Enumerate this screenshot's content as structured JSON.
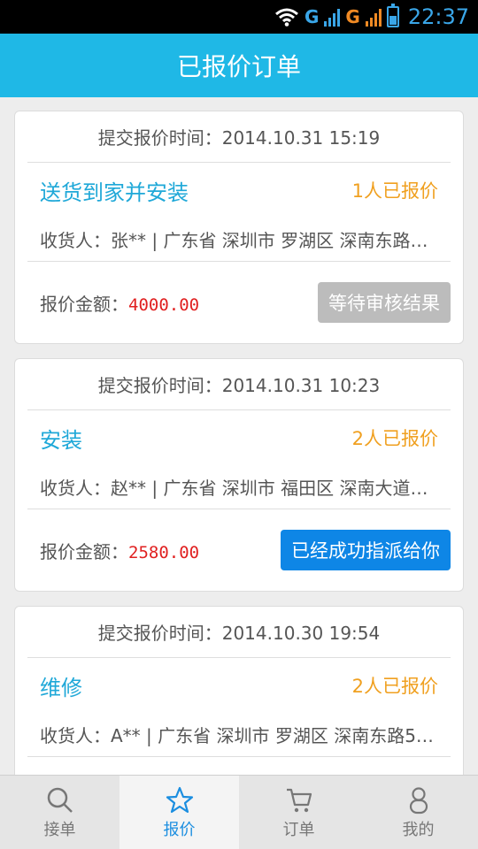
{
  "statusbar": {
    "net1": "G",
    "net2": "G",
    "time": "22:37"
  },
  "header": {
    "title": "已报价订单"
  },
  "orders": [
    {
      "submit_time": "提交报价时间：2014.10.31  15:19",
      "service": "送货到家并安装",
      "quote_count": "1人已报价",
      "receiver_label": "收货人：",
      "receiver": "张** | 广东省 深圳市 罗湖区 深南东路…",
      "price_label": "报价金额：",
      "price": "4000.00",
      "status_label": "等待审核结果",
      "status_style": "grey"
    },
    {
      "submit_time": "提交报价时间：2014.10.31  10:23",
      "service": "安装",
      "quote_count": "2人已报价",
      "receiver_label": "收货人：",
      "receiver": "赵** | 广东省 深圳市 福田区 深南大道…",
      "price_label": "报价金额：",
      "price": "2580.00",
      "status_label": "已经成功指派给你",
      "status_style": "blue"
    },
    {
      "submit_time": "提交报价时间：2014.10.30  19:54",
      "service": "维修",
      "quote_count": "2人已报价",
      "receiver_label": "收货人：",
      "receiver": "A** | 广东省 深圳市 罗湖区 深南东路5…",
      "price_label": "",
      "price": "",
      "status_label": "",
      "status_style": ""
    }
  ],
  "bottom_nav": [
    {
      "label": "接单",
      "icon": "search-icon",
      "active": false
    },
    {
      "label": "报价",
      "icon": "star-icon",
      "active": true
    },
    {
      "label": "订单",
      "icon": "cart-icon",
      "active": false
    },
    {
      "label": "我的",
      "icon": "person-icon",
      "active": false
    }
  ],
  "colors": {
    "accent": "#1fb8e6",
    "title": "#1fa8d8",
    "count": "#f0a020",
    "price": "#e02020",
    "button_blue": "#0e86e6",
    "button_grey": "#bcbcbc"
  }
}
